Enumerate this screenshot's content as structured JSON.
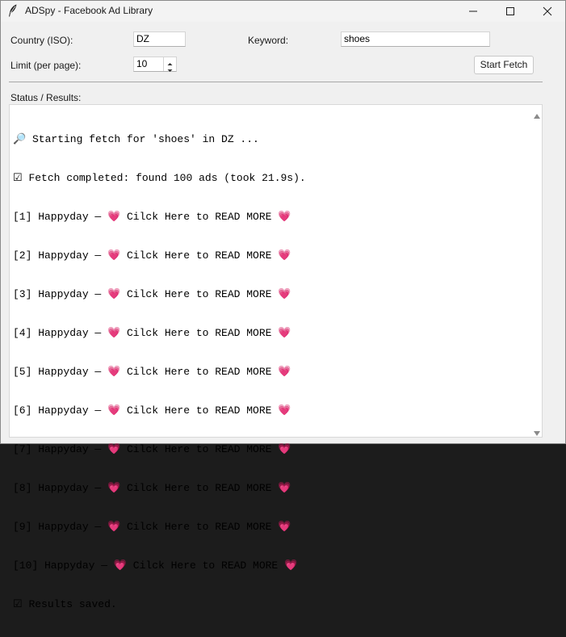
{
  "window": {
    "title": "ADSpy - Facebook Ad Library",
    "app_icon": "feather-quill-icon",
    "controls": [
      "minimize-icon",
      "maximize-icon",
      "close-icon"
    ]
  },
  "form": {
    "country_label": "Country (ISO):",
    "country_value": "DZ",
    "keyword_label": "Keyword:",
    "keyword_value": "shoes",
    "limit_label": "Limit (per page):",
    "limit_value": "10",
    "start_button": "Start Fetch"
  },
  "results": {
    "label": "Status / Results:",
    "lines": [
      "🔎 Starting fetch for 'shoes' in DZ ...",
      "☑ Fetch completed: found 100 ads (took 21.9s).",
      "[1] Happyday — 💗 Cilck Here to READ MORE 💗",
      "[2] Happyday — 💗 Cilck Here to READ MORE 💗",
      "[3] Happyday — 💗 Cilck Here to READ MORE 💗",
      "[4] Happyday — 💗 Cilck Here to READ MORE 💗",
      "[5] Happyday — 💗 Cilck Here to READ MORE 💗",
      "[6] Happyday — 💗 Cilck Here to READ MORE 💗",
      "[7] Happyday — 💗 Cilck Here to READ MORE 💗",
      "[8] Happyday — 💗 Cilck Here to READ MORE 💗",
      "[9] Happyday — 💗 Cilck Here to READ MORE 💗",
      "[10] Happyday — 💗 Cilck Here to READ MORE 💗",
      "☑ Results saved."
    ]
  },
  "colors": {
    "window_bg": "#f0f0f0",
    "text": "#000000",
    "field_bg": "#ffffff"
  }
}
